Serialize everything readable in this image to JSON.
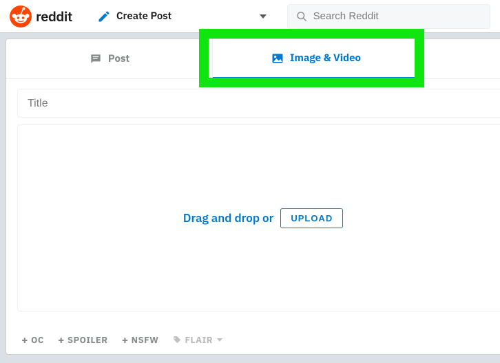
{
  "header": {
    "brand": "reddit",
    "create_label": "Create Post",
    "search_placeholder": "Search Reddit"
  },
  "tabs": {
    "post": {
      "label": "Post"
    },
    "image_video": {
      "label": "Image & Video"
    }
  },
  "form": {
    "title_placeholder": "Title",
    "drop_text": "Drag and drop or",
    "upload_label": "UPLOAD"
  },
  "tags": {
    "oc": "OC",
    "spoiler": "SPOILER",
    "nsfw": "NSFW",
    "flair": "FLAIR"
  }
}
